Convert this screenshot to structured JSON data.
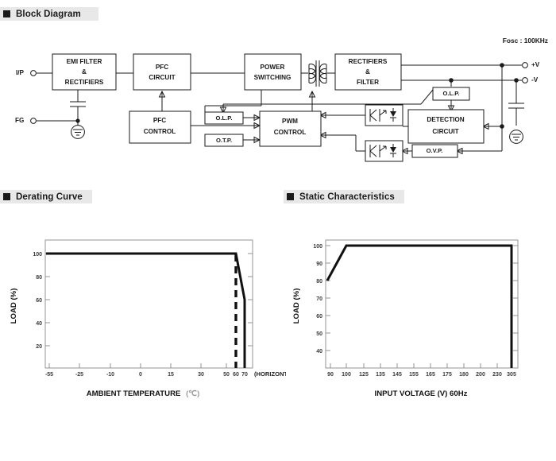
{
  "sections": {
    "block_diagram": {
      "title": "Block Diagram"
    },
    "derating_curve": {
      "title": "Derating Curve"
    },
    "static_characteristics": {
      "title": "Static Characteristics"
    }
  },
  "block_diagram": {
    "note": "Fosc : 100KHz",
    "terminals": [
      {
        "id": "ip",
        "label": "I/P"
      },
      {
        "id": "fg",
        "label": "FG"
      },
      {
        "id": "vplus",
        "label": "+V"
      },
      {
        "id": "vminus",
        "label": "-V"
      }
    ],
    "blocks": [
      {
        "id": "emi-filter-rectifiers",
        "lines": [
          "EMI FILTER",
          "&",
          "RECTIFIERS"
        ]
      },
      {
        "id": "pfc-circuit",
        "lines": [
          "PFC",
          "CIRCUIT"
        ]
      },
      {
        "id": "power-switching",
        "lines": [
          "POWER",
          "SWITCHING"
        ]
      },
      {
        "id": "rectifiers-filter",
        "lines": [
          "RECTIFIERS",
          "&",
          "FILTER"
        ]
      },
      {
        "id": "pfc-control",
        "lines": [
          "PFC",
          "CONTROL"
        ]
      },
      {
        "id": "pwm-control",
        "lines": [
          "PWM",
          "CONTROL"
        ]
      },
      {
        "id": "detection-circuit",
        "lines": [
          "DETECTION",
          "CIRCUIT"
        ]
      },
      {
        "id": "olp-left",
        "lines": [
          "O.L.P."
        ]
      },
      {
        "id": "otp",
        "lines": [
          "O.T.P."
        ]
      },
      {
        "id": "olp-right",
        "lines": [
          "O.L.P."
        ]
      },
      {
        "id": "ovp",
        "lines": [
          "O.V.P."
        ]
      }
    ]
  },
  "chart_data": [
    {
      "id": "derating-curve",
      "type": "line",
      "title": "Derating Curve",
      "xlabel": "AMBIENT TEMPERATURE",
      "xlabel_unit": "(℃)",
      "ylabel": "LOAD (%)",
      "xticks": [
        "-55",
        "-25",
        "-10",
        "0",
        "15",
        "30",
        "50",
        "60",
        "70"
      ],
      "xtick_values": [
        -55,
        -25,
        -10,
        0,
        15,
        30,
        50,
        60,
        70
      ],
      "yticks": [
        "20",
        "40",
        "60",
        "80",
        "100"
      ],
      "ytick_values": [
        20,
        40,
        60,
        80,
        100
      ],
      "xlim": [
        -55,
        75
      ],
      "ylim": [
        0,
        112
      ],
      "grid": false,
      "annotation": "(HORIZONTAL)",
      "series": [
        {
          "name": "derating",
          "style": "solid",
          "x": [
            -55,
            60,
            70,
            70
          ],
          "y": [
            100,
            100,
            60,
            0
          ]
        },
        {
          "name": "vertical-limit",
          "style": "dashed",
          "x": [
            60,
            60
          ],
          "y": [
            100,
            0
          ]
        }
      ]
    },
    {
      "id": "static-characteristics",
      "type": "line",
      "title": "Static Characteristics",
      "xlabel": "INPUT VOLTAGE (V) 60Hz",
      "ylabel": "LOAD (%)",
      "xticks": [
        "90",
        "100",
        "125",
        "135",
        "145",
        "155",
        "165",
        "175",
        "180",
        "200",
        "230",
        "305"
      ],
      "xtick_values": [
        90,
        100,
        125,
        135,
        145,
        155,
        165,
        175,
        180,
        200,
        230,
        305
      ],
      "yticks": [
        "40",
        "50",
        "60",
        "70",
        "80",
        "90",
        "100"
      ],
      "ytick_values": [
        40,
        50,
        60,
        70,
        80,
        90,
        100
      ],
      "xlim": [
        85,
        320
      ],
      "ylim": [
        30,
        105
      ],
      "grid": false,
      "series": [
        {
          "name": "static",
          "style": "solid",
          "x": [
            90,
            100,
            305,
            305
          ],
          "y": [
            80,
            100,
            100,
            30
          ]
        }
      ]
    }
  ],
  "colors": {
    "header_bg": "#e8e8e8",
    "ink": "#1a1a1a",
    "axis": "#8a8a8a",
    "curve": "#111111"
  }
}
